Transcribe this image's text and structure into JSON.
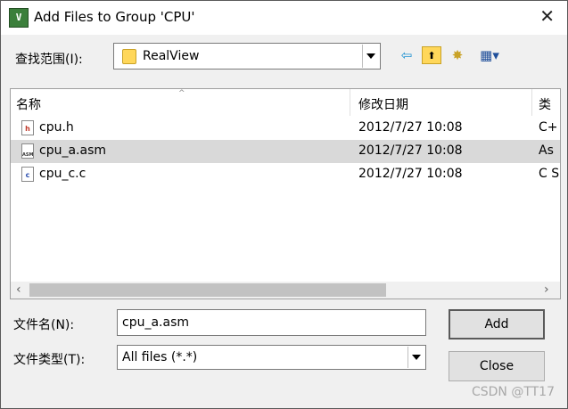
{
  "window": {
    "title": "Add Files to Group 'CPU'",
    "close_glyph": "✕"
  },
  "look_in": {
    "label": "查找范围(I):",
    "value": "RealView"
  },
  "toolbar": {
    "back_glyph": "⇦",
    "up_glyph": "⬆",
    "new_folder_glyph": "✸",
    "view_menu_glyph": "▦▾"
  },
  "columns": {
    "name": "名称",
    "date": "修改日期",
    "type": "类"
  },
  "files": [
    {
      "icon": "h",
      "name": "cpu.h",
      "date": "2012/7/27 10:08",
      "type": "C+",
      "selected": false
    },
    {
      "icon": "ASM",
      "name": "cpu_a.asm",
      "date": "2012/7/27 10:08",
      "type": "As",
      "selected": true
    },
    {
      "icon": "c",
      "name": "cpu_c.c",
      "date": "2012/7/27 10:08",
      "type": "C S",
      "selected": false
    }
  ],
  "scroll": {
    "left": "‹",
    "right": "›"
  },
  "file_name": {
    "label": "文件名(N):",
    "value": "cpu_a.asm"
  },
  "file_type": {
    "label": "文件类型(T):",
    "value": "All files (*.*)"
  },
  "buttons": {
    "add": "Add",
    "close": "Close"
  },
  "watermark": "CSDN @TT17",
  "colors": {
    "selection": "#d9d9d9",
    "icon_green": "#3b7f3b",
    "folder": "#ffd75a"
  }
}
